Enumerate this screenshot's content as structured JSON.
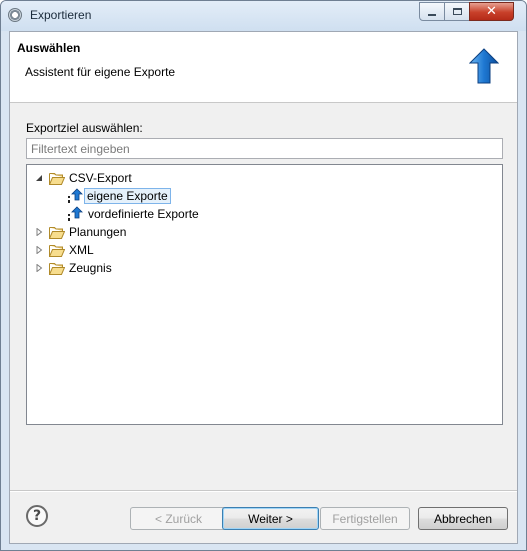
{
  "window": {
    "title": "Exportieren"
  },
  "banner": {
    "title": "Auswählen",
    "description": "Assistent für eigene Exporte"
  },
  "main": {
    "target_label": "Exportziel auswählen:",
    "filter_placeholder": "Filtertext eingeben",
    "filter_value": ""
  },
  "tree": [
    {
      "label": "CSV-Export",
      "expanded": true,
      "icon": "folder-icon",
      "children": [
        {
          "label": "eigene Exporte",
          "icon": "export-icon",
          "selected": true
        },
        {
          "label": "vordefinierte Exporte",
          "icon": "export-icon",
          "selected": false
        }
      ]
    },
    {
      "label": "Planungen",
      "expanded": false,
      "icon": "folder-icon"
    },
    {
      "label": "XML",
      "expanded": false,
      "icon": "folder-icon"
    },
    {
      "label": "Zeugnis",
      "expanded": false,
      "icon": "folder-icon"
    }
  ],
  "buttons": {
    "help": "?",
    "back": "< Zurück",
    "next": "Weiter >",
    "finish": "Fertigstellen",
    "cancel": "Abbrechen"
  },
  "buttons_state": {
    "back_enabled": false,
    "next_enabled": true,
    "finish_enabled": false,
    "cancel_enabled": true
  },
  "colors": {
    "accent": "#1e78d2",
    "selection_bg": "#e5f1fb",
    "selection_border": "#7eb4ea",
    "folder": "#e8b84a"
  }
}
